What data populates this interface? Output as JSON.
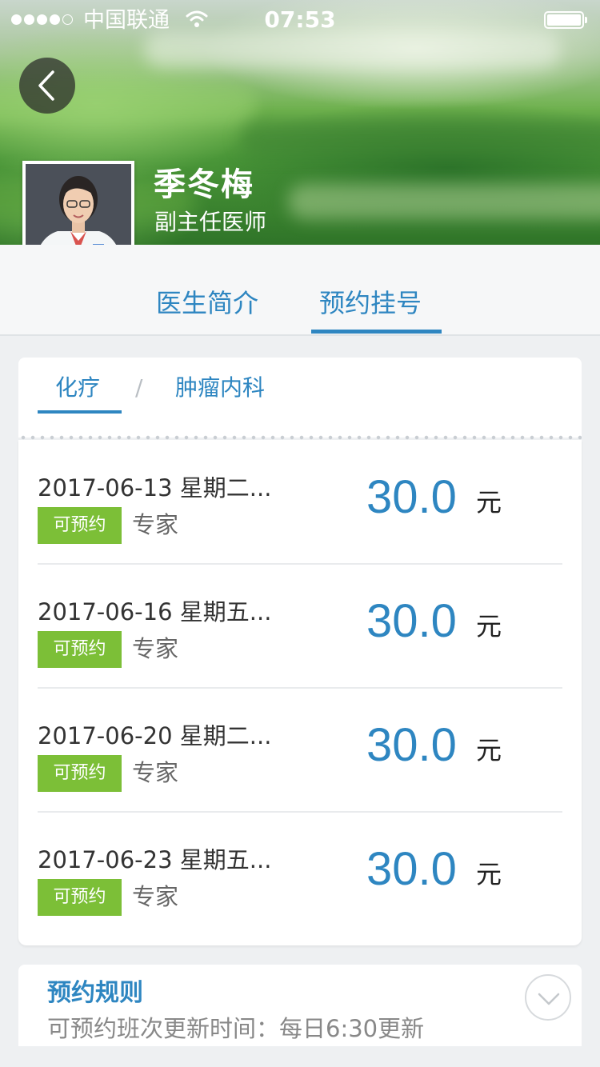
{
  "status_bar": {
    "carrier": "中国联通",
    "time": "07:53"
  },
  "doctor": {
    "name": "季冬梅",
    "title": "副主任医师"
  },
  "tabs": [
    {
      "label": "医生简介"
    },
    {
      "label": "预约挂号"
    }
  ],
  "department": {
    "primary": "化疗",
    "separator": "/",
    "secondary": "肿瘤内科"
  },
  "schedule": [
    {
      "date": "2017-06-13 星期二...",
      "status": "可预约",
      "type": "专家",
      "price": "30.0",
      "unit": "元"
    },
    {
      "date": "2017-06-16 星期五...",
      "status": "可预约",
      "type": "专家",
      "price": "30.0",
      "unit": "元"
    },
    {
      "date": "2017-06-20 星期二...",
      "status": "可预约",
      "type": "专家",
      "price": "30.0",
      "unit": "元"
    },
    {
      "date": "2017-06-23 星期五...",
      "status": "可预约",
      "type": "专家",
      "price": "30.0",
      "unit": "元"
    }
  ],
  "rules": {
    "title": "预约规则",
    "text": "可预约班次更新时间：每日6:30更新"
  },
  "colors": {
    "accent": "#2e86c1",
    "badge": "#7cbf37"
  },
  "icons": {
    "back": "chevron-left-icon",
    "expand": "chevron-down-icon",
    "wifi": "wifi-icon",
    "battery": "battery-icon"
  }
}
